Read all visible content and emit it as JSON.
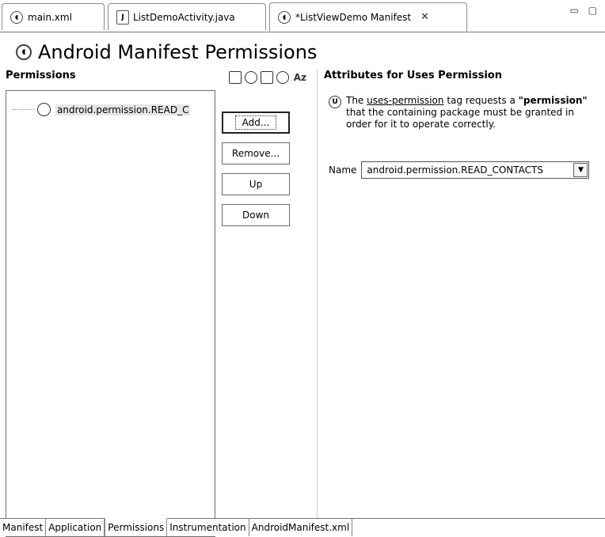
{
  "editor_tabs": [
    {
      "label": "main.xml",
      "icon": "manifest-icon"
    },
    {
      "label": "ListDemoActivity.java",
      "icon": "java-file-icon"
    },
    {
      "label": "*ListViewDemo Manifest",
      "icon": "manifest-icon",
      "active": true
    }
  ],
  "page": {
    "title": "Android Manifest Permissions"
  },
  "permissions": {
    "header": "Permissions",
    "sort_label": "Az",
    "items": [
      "android.permission.READ_C"
    ],
    "buttons": {
      "add": "Add...",
      "remove": "Remove...",
      "up": "Up",
      "down": "Down"
    }
  },
  "attributes": {
    "header": "Attributes for Uses Permission",
    "icon_letter": "U",
    "desc_pre": "The ",
    "desc_link": "uses-permission",
    "desc_mid": " tag requests a ",
    "desc_bold": "\"permission\"",
    "desc_post": " that the containing package must be granted in order for it to operate correctly.",
    "name_label": "Name",
    "name_value": "android.permission.READ_CONTACTS"
  },
  "bottom_tabs": [
    {
      "label": "Manifest"
    },
    {
      "label": "Application"
    },
    {
      "label": "Permissions",
      "active": true
    },
    {
      "label": "Instrumentation"
    },
    {
      "label": "AndroidManifest.xml"
    }
  ]
}
